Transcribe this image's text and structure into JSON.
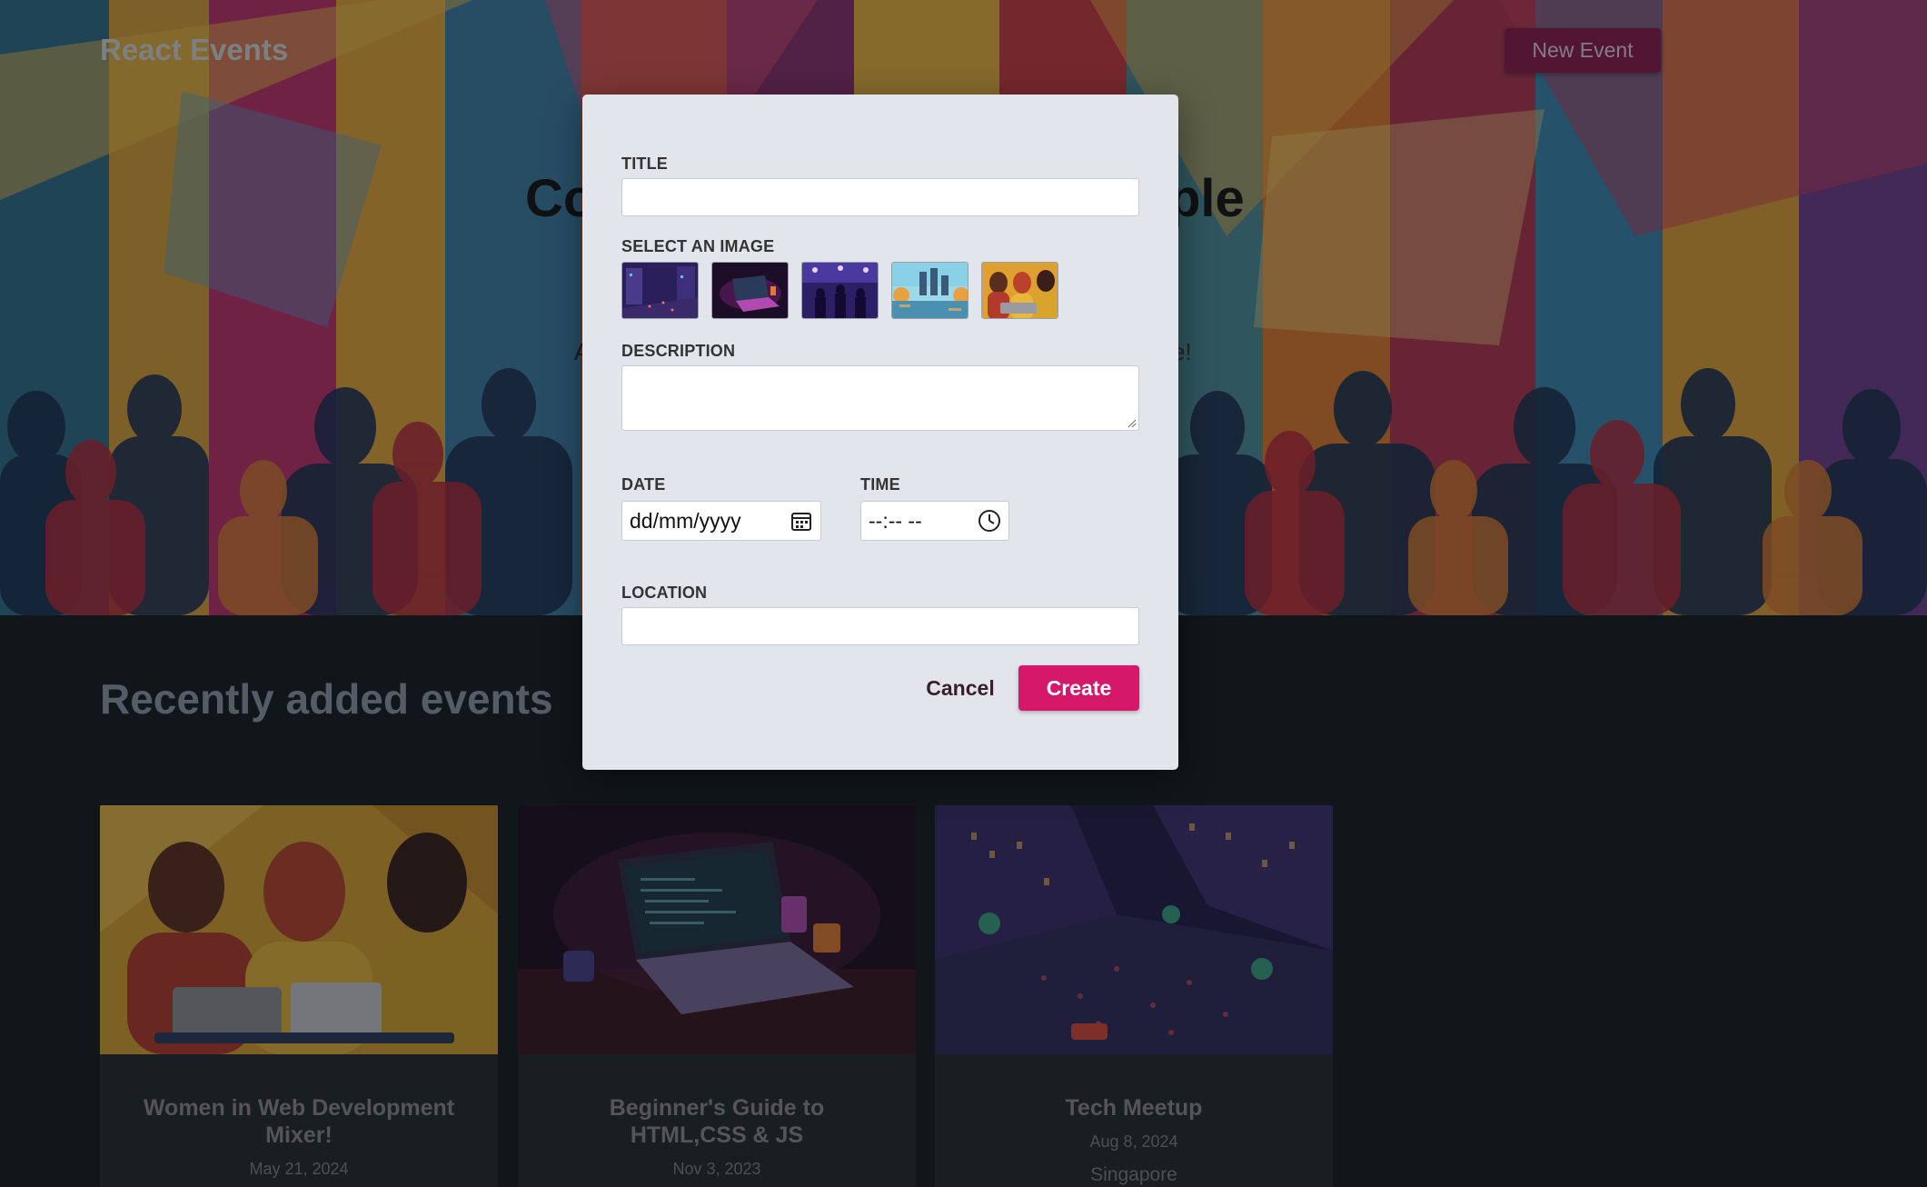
{
  "nav": {
    "brand": "React Events",
    "new_event_label": "New Event"
  },
  "hero": {
    "heading_left": "Co",
    "heading_right": "ple",
    "subtitle_left": "A",
    "subtitle_right": "e!"
  },
  "recent": {
    "title": "Recently added events",
    "events": [
      {
        "title": "Women in Web Development Mixer!",
        "date": "May 21, 2024",
        "location": ""
      },
      {
        "title": "Beginner's Guide to HTML,CSS & JS",
        "date": "Nov 3, 2023",
        "location": ""
      },
      {
        "title": "Tech Meetup",
        "date": "Aug 8, 2024",
        "location": "Singapore"
      }
    ]
  },
  "modal": {
    "title_label": "TITLE",
    "title_value": "",
    "image_label": "SELECT AN IMAGE",
    "image_options": [
      "city-night-image",
      "laptop-desk-image",
      "concert-image",
      "city-river-image",
      "women-laptop-image"
    ],
    "description_label": "DESCRIPTION",
    "description_value": "",
    "date_label": "DATE",
    "date_placeholder": "dd/mm/yyyy",
    "time_label": "TIME",
    "time_placeholder": "--:-- --",
    "location_label": "LOCATION",
    "location_value": "",
    "cancel_label": "Cancel",
    "create_label": "Create"
  },
  "colors": {
    "accent": "#d6186a",
    "modal_bg": "#e3e5ec",
    "page_bg": "#151a1f"
  }
}
